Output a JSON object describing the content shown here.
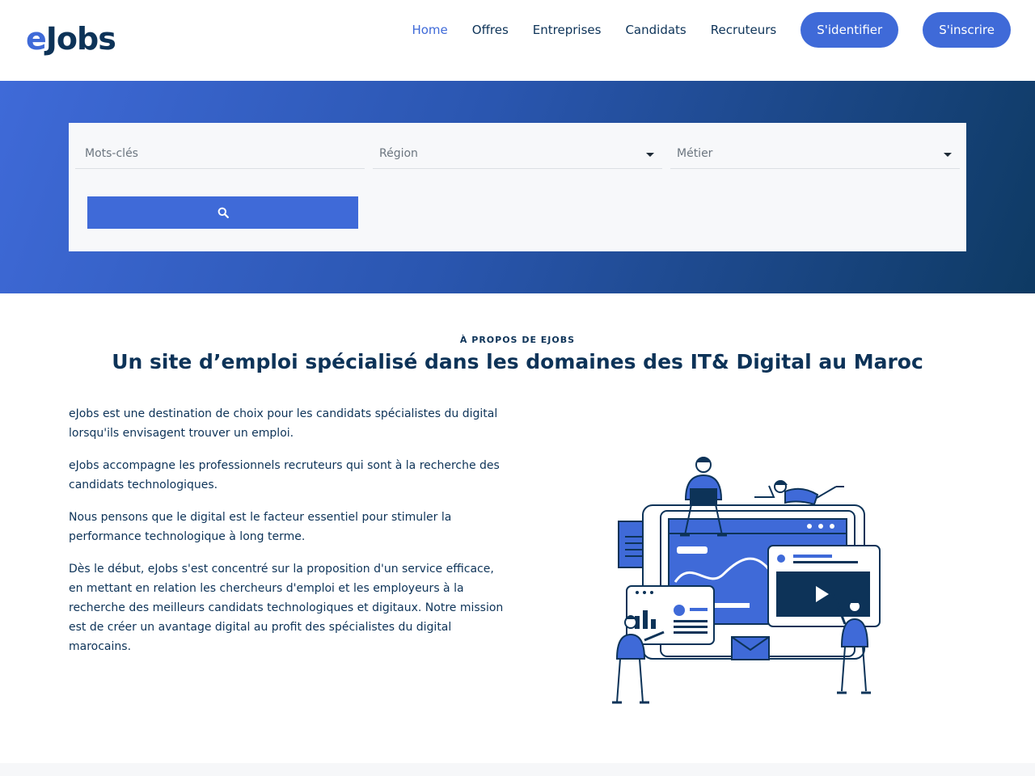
{
  "header": {
    "logo_prefix": "e",
    "logo_rest": "Jobs",
    "nav": {
      "home": "Home",
      "offres": "Offres",
      "entreprises": "Entreprises",
      "candidats": "Candidats",
      "recruteurs": "Recruteurs"
    },
    "login_label": "S'identifier",
    "signup_label": "S'inscrire"
  },
  "search": {
    "keywords_placeholder": "Mots-clés",
    "region_placeholder": "Région",
    "metier_placeholder": "Métier",
    "search_icon": "search-icon"
  },
  "about": {
    "eyebrow": "À PROPOS DE EJOBS",
    "title": "Un site d’emploi spécialisé dans les domaines des IT& Digital au Maroc",
    "paragraphs": [
      "eJobs est une destination de choix pour les candidats spécialistes du digital lorsqu'ils envisagent trouver un emploi.",
      "eJobs accompagne les professionnels recruteurs qui sont à la recherche des candidats technologiques.",
      "Nous pensons que le digital est le facteur essentiel pour stimuler la performance technologique à long terme.",
      "Dès le début, eJobs s'est concentré sur la proposition d'un service efficace, en mettant en relation les chercheurs d'emploi et les employeurs à la recherche des meilleurs candidats technologiques et digitaux. Notre mission est de créer un avantage digital au profit des spécialistes du digital marocains."
    ]
  },
  "colors": {
    "primary": "#3f6ad8",
    "navy": "#0d3358",
    "gradient_end": "#0e3a63"
  }
}
